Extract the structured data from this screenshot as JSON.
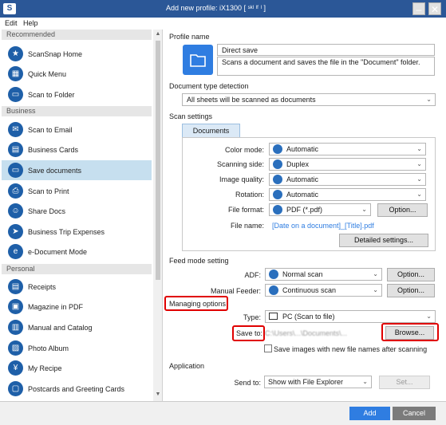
{
  "window": {
    "title": "Add new profile: iX1300 [ ˢᵏˡ ˡᶠ ˡ ]",
    "logo_glyph": "S",
    "minimize_glyph": "–",
    "close_glyph": "✕"
  },
  "menu": {
    "edit": "Edit",
    "help": "Help"
  },
  "sidebar": {
    "sections": {
      "recommended": "Recommended",
      "business": "Business",
      "personal": "Personal"
    },
    "items": [
      {
        "label": "ScanSnap Home",
        "icon": "star-icon",
        "glyph": "★"
      },
      {
        "label": "Quick Menu",
        "icon": "grid-icon",
        "glyph": "▦"
      },
      {
        "label": "Scan to Folder",
        "icon": "folder-icon",
        "glyph": "▭"
      },
      {
        "label": "Scan to Email",
        "icon": "email-icon",
        "glyph": "✉"
      },
      {
        "label": "Business Cards",
        "icon": "card-icon",
        "glyph": "▤"
      },
      {
        "label": "Save documents",
        "icon": "folder-icon",
        "glyph": "▭"
      },
      {
        "label": "Scan to Print",
        "icon": "print-icon",
        "glyph": "⎙"
      },
      {
        "label": "Share Docs",
        "icon": "people-icon",
        "glyph": "☺"
      },
      {
        "label": "Business Trip Expenses",
        "icon": "plane-icon",
        "glyph": "➤"
      },
      {
        "label": "e-Document Mode",
        "icon": "edocument-icon",
        "glyph": "e"
      },
      {
        "label": "Receipts",
        "icon": "receipt-icon",
        "glyph": "▤"
      },
      {
        "label": "Magazine in PDF",
        "icon": "magazine-icon",
        "glyph": "▣"
      },
      {
        "label": "Manual and Catalog",
        "icon": "book-icon",
        "glyph": "▥"
      },
      {
        "label": "Photo Album",
        "icon": "photo-icon",
        "glyph": "▨"
      },
      {
        "label": "My Recipe",
        "icon": "cutlery-icon",
        "glyph": "¥"
      },
      {
        "label": "Postcards and Greeting Cards",
        "icon": "postcard-icon",
        "glyph": "▢"
      }
    ],
    "selected": "Save documents"
  },
  "profile": {
    "heading": "Profile name",
    "name_value": "Direct save",
    "description_value": "Scans a document and saves the file in the \"Document\" folder."
  },
  "doc_type": {
    "heading": "Document type detection",
    "value": "All sheets will be scanned as documents"
  },
  "scan_settings": {
    "heading": "Scan settings",
    "tab": "Documents",
    "color_mode_label": "Color mode:",
    "color_mode_value": "Automatic",
    "scanning_side_label": "Scanning side:",
    "scanning_side_value": "Duplex",
    "image_quality_label": "Image quality:",
    "image_quality_value": "Automatic",
    "rotation_label": "Rotation:",
    "rotation_value": "Automatic",
    "file_format_label": "File format:",
    "file_format_value": "PDF (*.pdf)",
    "option_button": "Option...",
    "file_name_label": "File name:",
    "file_name_value": "[Date on a document]_[Title].pdf",
    "detailed_button": "Detailed settings..."
  },
  "feed": {
    "heading": "Feed mode setting",
    "adf_label": "ADF:",
    "adf_value": "Normal scan",
    "manual_label": "Manual Feeder:",
    "manual_value": "Continuous scan",
    "option_button": "Option..."
  },
  "managing": {
    "heading": "Managing options",
    "type_label": "Type:",
    "type_value": "PC (Scan to file)",
    "save_to_label": "Save to:",
    "save_to_value": "C:\\Users\\...\\Documents\\...",
    "browse_button": "Browse...",
    "new_names_checkbox": "Save images with new file names after scanning"
  },
  "application": {
    "heading": "Application",
    "send_to_label": "Send to:",
    "send_to_value": "Show with File Explorer",
    "set_button": "Set..."
  },
  "footer": {
    "add_button": "Add",
    "cancel_button": "Cancel"
  },
  "colors": {
    "titlebar": "#2b5797",
    "accent": "#2f7de1",
    "highlight": "#e00000",
    "selected_row": "#c6dfef"
  }
}
